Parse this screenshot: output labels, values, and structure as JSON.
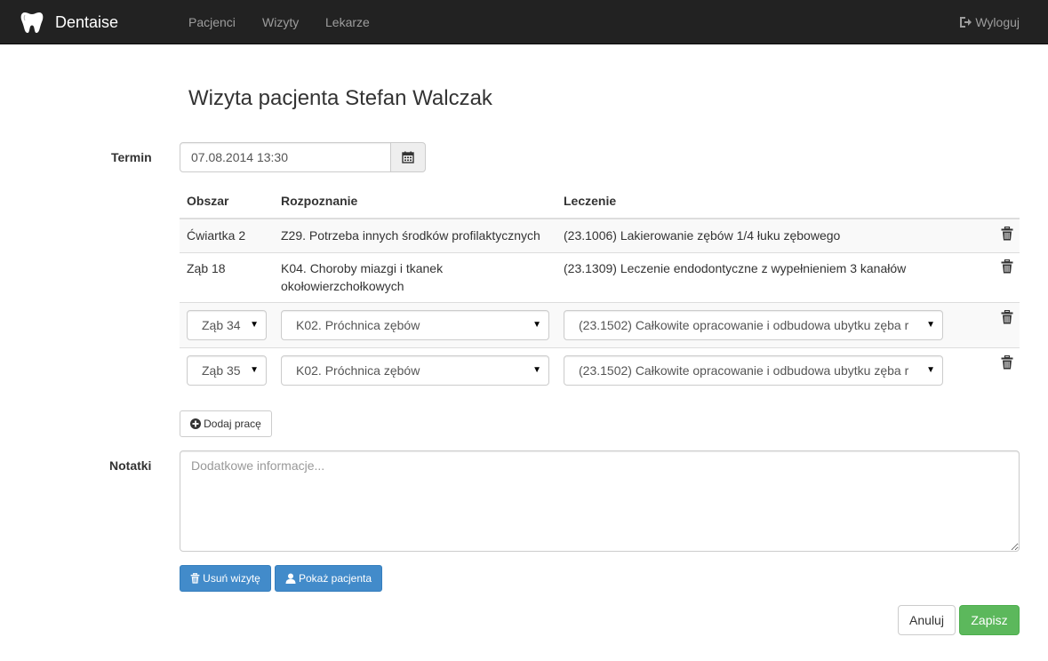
{
  "nav": {
    "brand": "Dentaise",
    "links": [
      "Pacjenci",
      "Wizyty",
      "Lekarze"
    ],
    "logout": "Wyloguj"
  },
  "page": {
    "title": "Wizyta pacjenta Stefan Walczak"
  },
  "form": {
    "termin_label": "Termin",
    "termin_value": "07.08.2014 13:30",
    "notatki_label": "Notatki",
    "notatki_placeholder": "Dodatkowe informacje..."
  },
  "table": {
    "headers": [
      "Obszar",
      "Rozpoznanie",
      "Leczenie"
    ],
    "rows": [
      {
        "obszar": "Ćwiartka 2",
        "rozpoznanie": "Z29. Potrzeba innych środków profilaktycznych",
        "leczenie": "(23.1006) Lakierowanie zębów 1/4 łuku zębowego"
      },
      {
        "obszar": "Ząb 18",
        "rozpoznanie_line1": "K04. Choroby miazgi i tkanek",
        "rozpoznanie_line2": "okołowierzchołkowych",
        "leczenie": "(23.1309) Leczenie endodontyczne z wypełnieniem 3 kanałów"
      }
    ],
    "edit_rows": [
      {
        "obszar": "Ząb 34",
        "rozpoznanie": "K02. Próchnica zębów",
        "leczenie": "(23.1502) Całkowite opracowanie i odbudowa ubytku zęba r"
      },
      {
        "obszar": "Ząb 35",
        "rozpoznanie": "K02. Próchnica zębów",
        "leczenie": "(23.1502) Całkowite opracowanie i odbudowa ubytku zęba r"
      }
    ]
  },
  "buttons": {
    "add_work": "Dodaj pracę",
    "delete_visit": "Usuń wizytę",
    "show_patient": "Pokaż pacjenta",
    "cancel": "Anuluj",
    "save": "Zapisz"
  },
  "icons": {
    "brand": "tooth-icon",
    "logout": "log-out-icon",
    "calendar": "calendar-icon",
    "trash": "trash-icon",
    "add": "plus-circle-icon",
    "user": "user-icon"
  },
  "colors": {
    "navbar": "#222222",
    "primary": "#428bca",
    "success": "#5cb85c",
    "stripe": "#f9f9f9"
  }
}
